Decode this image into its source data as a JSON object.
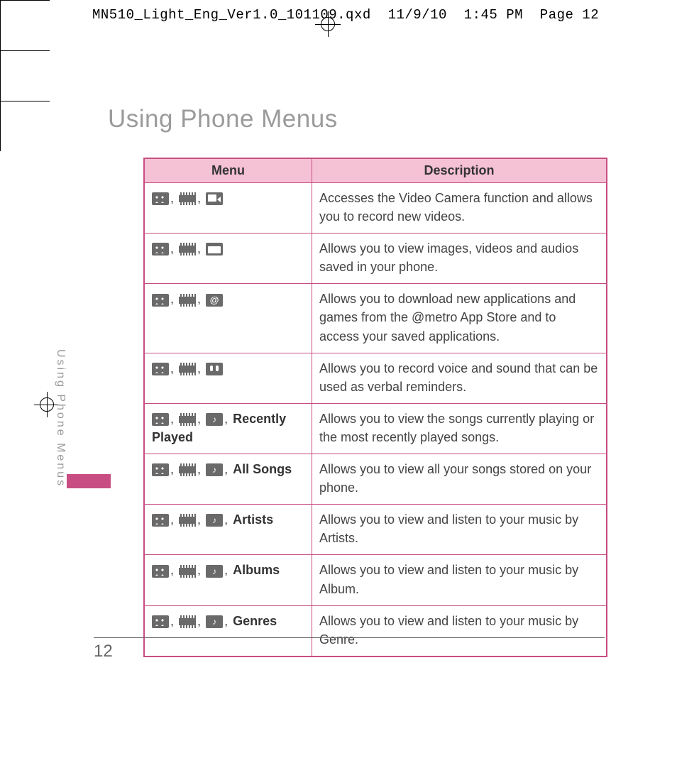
{
  "print_header": "MN510_Light_Eng_Ver1.0_101109.qxd  11/9/10  1:45 PM  Page 12",
  "page_title": "Using Phone Menus",
  "side_tab": "Using Phone Menus",
  "page_number": "12",
  "table": {
    "headers": {
      "menu": "Menu",
      "description": "Description"
    },
    "rows": [
      {
        "icons": [
          "grid",
          "film",
          "cam"
        ],
        "label": "",
        "description": "Accesses the Video Camera function and allows you to record new videos."
      },
      {
        "icons": [
          "grid",
          "film",
          "folder"
        ],
        "label": "",
        "description": "Allows you to view images, videos and audios saved in your phone."
      },
      {
        "icons": [
          "grid",
          "film",
          "at"
        ],
        "label": "",
        "description": "Allows you to download new applications and games from the @metro App Store and to access your saved applications."
      },
      {
        "icons": [
          "grid",
          "film",
          "voice"
        ],
        "label": "",
        "description": "Allows you to record voice and sound that can be used as verbal reminders."
      },
      {
        "icons": [
          "grid",
          "film",
          "note"
        ],
        "label": "Recently Played",
        "description": "Allows you to view the songs currently playing or the most recently played songs."
      },
      {
        "icons": [
          "grid",
          "film",
          "note"
        ],
        "label": "All Songs",
        "description": "Allows you to view all your songs stored on your phone."
      },
      {
        "icons": [
          "grid",
          "film",
          "note"
        ],
        "label": "Artists",
        "description": "Allows you to view and listen to your music by Artists."
      },
      {
        "icons": [
          "grid",
          "film",
          "note"
        ],
        "label": "Albums",
        "description": "Allows you to view and listen to your music by Album."
      },
      {
        "icons": [
          "grid",
          "film",
          "note"
        ],
        "label": "Genres",
        "description": "Allows you to view and listen to your music by Genre."
      }
    ]
  }
}
